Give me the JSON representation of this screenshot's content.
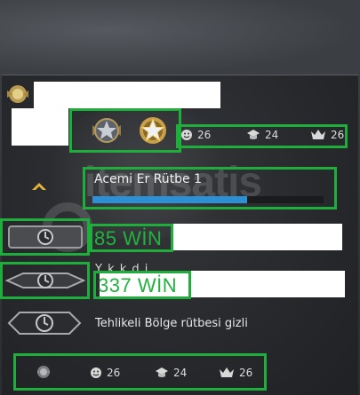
{
  "profile": {
    "medals": [
      "medal-silver-icon",
      "medal-gold-star-icon"
    ],
    "stats": {
      "friendly": "26",
      "teacher": "24",
      "leader": "26"
    }
  },
  "rank": {
    "title": "Acemi Er Rütbe 1",
    "xp_progress": 0.67
  },
  "wingman": {
    "wins": "85 WİN"
  },
  "competitive": {
    "partial_label": "Y k         k            d   i",
    "wins": "337 WİN"
  },
  "danger_zone": {
    "label": "Tehlikeli Bölge rütbesi gizli"
  },
  "footer_stats": {
    "friendly": "26",
    "teacher": "24",
    "leader": "26"
  },
  "watermark": {
    "text": "itemsatis"
  },
  "colors": {
    "highlight": "#1fae3c",
    "xp_bar": "#2d8fd4",
    "wins_text": "#22b33f"
  }
}
